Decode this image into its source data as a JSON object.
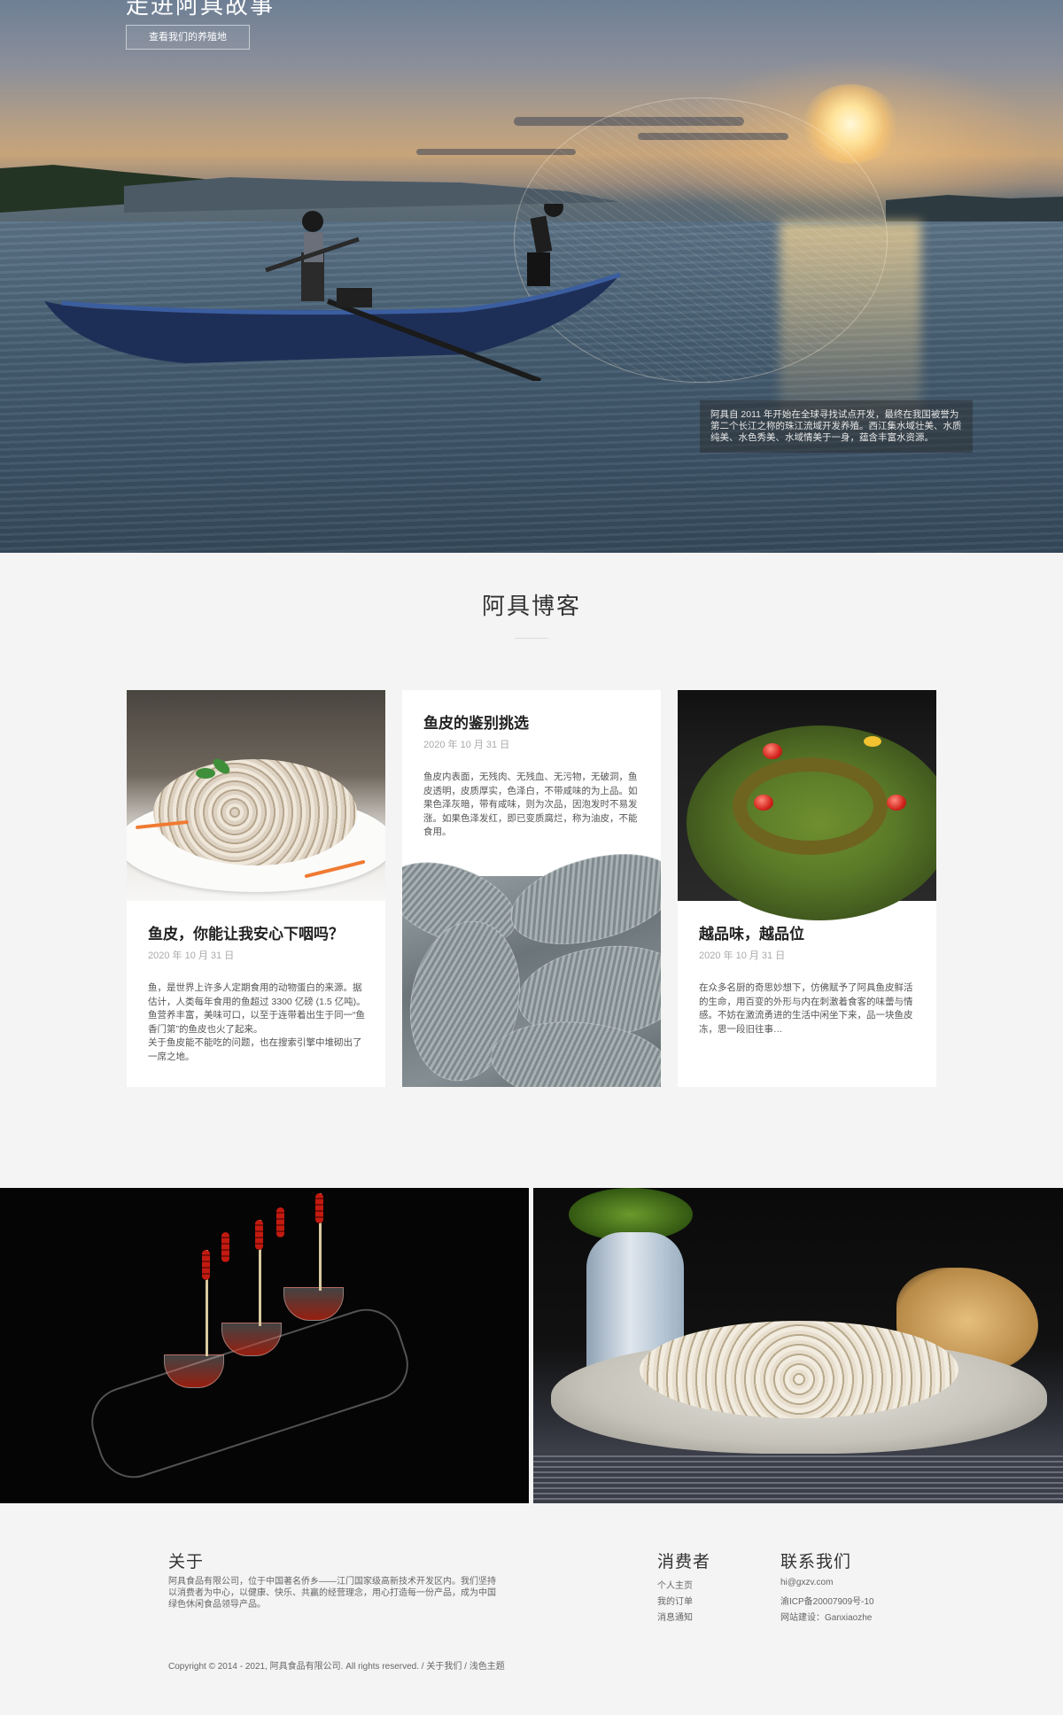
{
  "hero": {
    "title": "走进阿具故事",
    "button_label": "查看我们的养殖地",
    "caption": "阿具自 2011 年开始在全球寻找试点开发，最终在我国被誉为第二个长江之称的珠江流域开发养殖。西江集水域壮美、水质纯美、水色秀美、水域情美于一身，蕴含丰富水资源。"
  },
  "blog": {
    "heading": "阿具博客",
    "cards": [
      {
        "title": "鱼皮，你能让我安心下咽吗？",
        "date": "2020 年 10 月 31 日",
        "text": "鱼，是世界上许多人定期食用的动物蛋白的来源。据估计，人类每年食用的鱼超过 3300 亿磅 (1.5 亿吨)。鱼营养丰富，美味可口，以至于连带着出生于同一“鱼香门第”的鱼皮也火了起来。\n关于鱼皮能不能吃的问题，也在搜索引擎中堆砌出了一席之地。"
      },
      {
        "title": "鱼皮的鉴别挑选",
        "date": "2020 年 10 月 31 日",
        "text": "鱼皮内表面，无残肉、无残血、无污物，无破洞，鱼皮透明，皮质厚实，色泽白，不带咸味的为上品。如果色泽灰暗，带有咸味，则为次品，因泡发时不易发涨。如果色泽发红，即已变质腐烂，称为油皮，不能食用。"
      },
      {
        "title": "越品味，越品位",
        "date": "2020 年 10 月 31 日",
        "text": "在众多名厨的奇思妙想下，仿佛赋予了阿具鱼皮鲜活的生命，用百变的外形与内在刺激着食客的味蕾与情感。不妨在激流勇进的生活中闲坐下来，品一块鱼皮冻，思一段旧往事…"
      }
    ]
  },
  "footer": {
    "about": {
      "title": "关于",
      "text": "阿具食品有限公司，位于中国著名侨乡——江门国家级高新技术开发区内。我们坚持以消费者为中心，以健康、快乐、共赢的经营理念，用心打造每一份产品，成为中国绿色休闲食品领导产品。"
    },
    "consumer": {
      "title": "消费者",
      "links": [
        "个人主页",
        "我的订单",
        "消息通知"
      ]
    },
    "contact": {
      "title": "联系我们",
      "email": "hi@gxzv.com",
      "icp": "渝ICP备20007909号-10",
      "builder": "网站建设：Ganxiaozhe"
    },
    "copyright": "Copyright © 2014 - 2021, 阿具食品有限公司. All rights reserved. /",
    "copyright_link1": "关于我们",
    "copyright_sep": "/",
    "copyright_link2": "浅色主题"
  },
  "colors": {
    "page_bg": "#f4f4f4",
    "card_bg": "#ffffff",
    "text_dark": "#222222",
    "text_muted": "#aaaaaa"
  }
}
